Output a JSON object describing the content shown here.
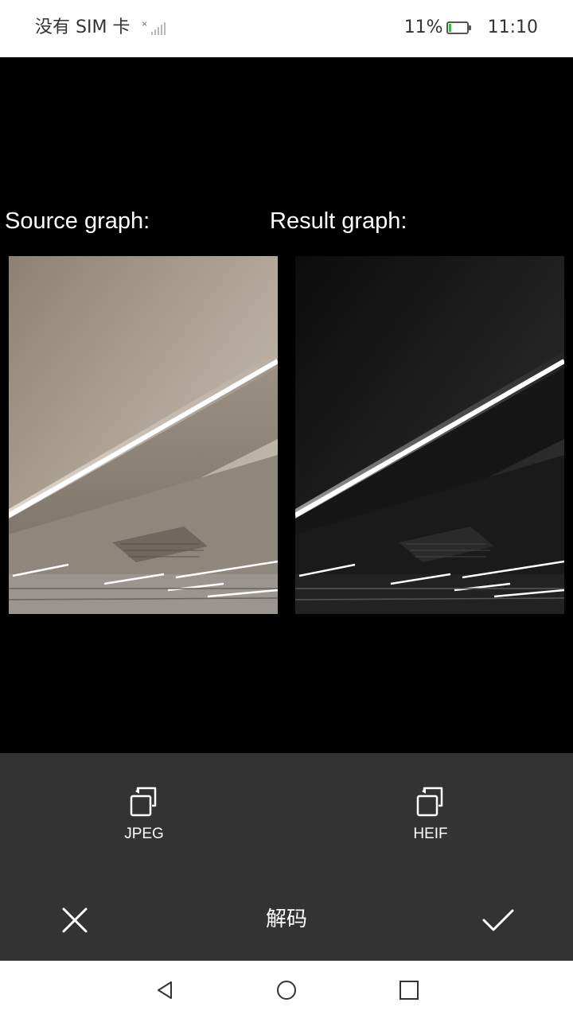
{
  "status_bar": {
    "carrier": "没有 SIM 卡",
    "battery_percent": "11%",
    "battery_level": 0.11,
    "time": "11:10",
    "signal_icon": "no-signal-icon",
    "battery_icon": "battery-low-icon"
  },
  "main": {
    "source_label": "Source graph:",
    "result_label": "Result graph:"
  },
  "panel": {
    "jpeg_label": "JPEG",
    "heif_label": "HEIF",
    "title": "解码",
    "format_icon": "rotate-copy-icon",
    "close_icon": "close-icon",
    "confirm_icon": "check-icon"
  },
  "nav": {
    "back_icon": "back-triangle-icon",
    "home_icon": "home-circle-icon",
    "recent_icon": "recent-square-icon"
  },
  "colors": {
    "panel_bg": "#333333",
    "content_bg": "#000000",
    "battery_level": "#3cb93c"
  }
}
